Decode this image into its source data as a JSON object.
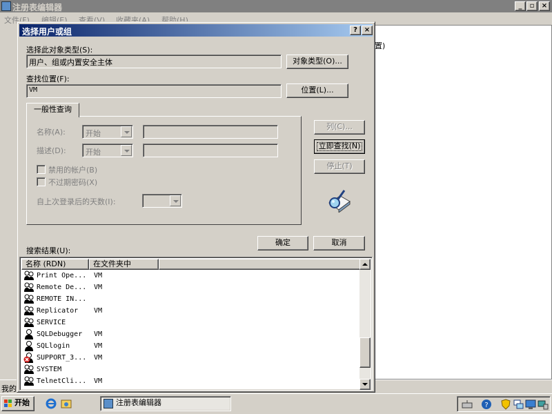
{
  "background": {
    "title": "注册表编辑器",
    "menu": [
      "文件(F)",
      "编辑(E)",
      "查看(V)",
      "收藏夹(A)",
      "帮助(H)"
    ],
    "right_text": "置)",
    "status": "我的"
  },
  "dialog": {
    "title": "选择用户或组",
    "object_types_label": "选择此对象类型(S):",
    "object_types_value": "用户、组或内置安全主体",
    "object_types_button": "对象类型(O)...",
    "location_label": "查找位置(F):",
    "location_value": "VM",
    "location_button": "位置(L)...",
    "tab_label": "一般性查询",
    "name_label": "名称(A):",
    "name_mode": "开始",
    "desc_label": "描述(D):",
    "desc_mode": "开始",
    "disabled_accounts": "禁用的帐户(B)",
    "nonexpiring_pw": "不过期密码(X)",
    "days_since_logon": "自上次登录后的天数(I):",
    "columns_button": "列(C)...",
    "find_now_button": "立即查找(N)",
    "stop_button": "停止(T)",
    "ok_button": "确定",
    "cancel_button": "取消",
    "results_label": "搜索结果(U):",
    "columns": [
      "名称 (RDN)",
      "在文件夹中"
    ],
    "rows": [
      {
        "name": "Print Ope...",
        "folder": "VM",
        "icon": "group-icon"
      },
      {
        "name": "Remote De...",
        "folder": "VM",
        "icon": "group-icon"
      },
      {
        "name": "REMOTE IN...",
        "folder": "",
        "icon": "group-icon"
      },
      {
        "name": "Replicator",
        "folder": "VM",
        "icon": "group-icon"
      },
      {
        "name": "SERVICE",
        "folder": "",
        "icon": "group-icon"
      },
      {
        "name": "SQLDebugger",
        "folder": "VM",
        "icon": "user-icon"
      },
      {
        "name": "SQLlogin",
        "folder": "VM",
        "icon": "user-icon"
      },
      {
        "name": "SUPPORT_3...",
        "folder": "VM",
        "icon": "disabled-user-icon"
      },
      {
        "name": "SYSTEM",
        "folder": "",
        "icon": "group-icon"
      },
      {
        "name": "TelnetCli...",
        "folder": "VM",
        "icon": "group-icon"
      }
    ]
  },
  "taskbar": {
    "start_label": "开始",
    "task_label": "注册表编辑器"
  },
  "colors": {
    "face": "#d4d0c8",
    "title_active": "#0a246a",
    "title_inactive": "#808080"
  }
}
